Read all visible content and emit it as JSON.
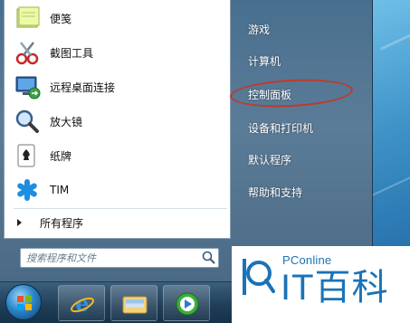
{
  "start_menu": {
    "programs": [
      {
        "label": "便笺",
        "icon": "sticky-notes-icon"
      },
      {
        "label": "截图工具",
        "icon": "snipping-tool-icon"
      },
      {
        "label": "远程桌面连接",
        "icon": "remote-desktop-icon"
      },
      {
        "label": "放大镜",
        "icon": "magnifier-icon"
      },
      {
        "label": "纸牌",
        "icon": "solitaire-icon"
      },
      {
        "label": "TIM",
        "icon": "tim-icon"
      }
    ],
    "all_programs_label": "所有程序",
    "search": {
      "placeholder": "搜索程序和文件"
    },
    "right_items": [
      {
        "label": "游戏"
      },
      {
        "label": "计算机"
      },
      {
        "label": "控制面板"
      },
      {
        "label": "设备和打印机"
      },
      {
        "label": "默认程序"
      },
      {
        "label": "帮助和支持"
      }
    ]
  },
  "watermark": {
    "small_text": "PConline",
    "big_text": "IT百科"
  },
  "colors": {
    "highlight": "#c0392b",
    "brand": "#1a73b8"
  }
}
